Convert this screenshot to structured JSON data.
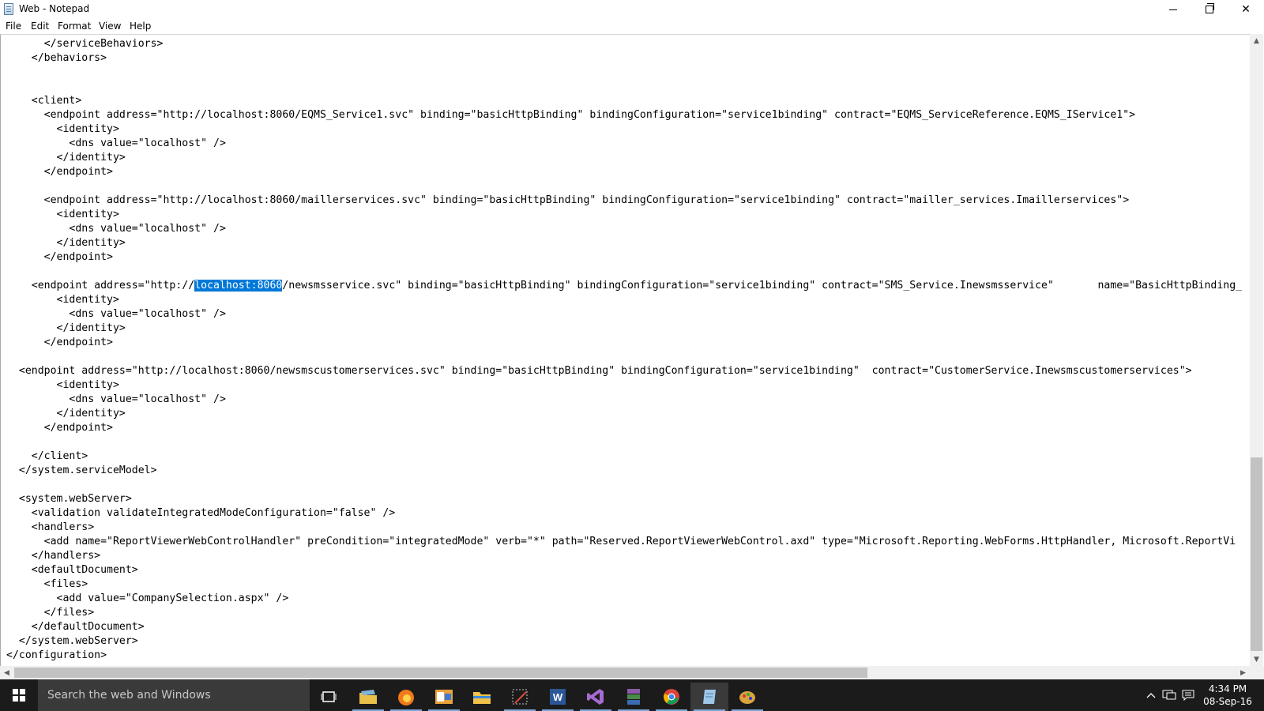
{
  "window": {
    "title": "Web - Notepad",
    "controls": {
      "minimize": "minimize",
      "maximize": "restore",
      "close": "✕"
    }
  },
  "menu": [
    "File",
    "Edit",
    "Format",
    "View",
    "Help"
  ],
  "editor": {
    "before_selection": "      </serviceBehaviors>\n    </behaviors>\n\n\n    <client>\n      <endpoint address=\"http://localhost:8060/EQMS_Service1.svc\" binding=\"basicHttpBinding\" bindingConfiguration=\"service1binding\" contract=\"EQMS_ServiceReference.EQMS_IService1\">\n        <identity>\n          <dns value=\"localhost\" />\n        </identity>\n      </endpoint>\n\n      <endpoint address=\"http://localhost:8060/maillerservices.svc\" binding=\"basicHttpBinding\" bindingConfiguration=\"service1binding\" contract=\"mailler_services.Imaillerservices\">\n        <identity>\n          <dns value=\"localhost\" />\n        </identity>\n      </endpoint>\n\n    <endpoint address=\"http://",
    "selected": "localhost:8060",
    "after_selection": "/newsmsservice.svc\" binding=\"basicHttpBinding\" bindingConfiguration=\"service1binding\" contract=\"SMS_Service.Inewsmsservice\"       name=\"BasicHttpBinding_\n        <identity>\n          <dns value=\"localhost\" />\n        </identity>\n      </endpoint>\n\n  <endpoint address=\"http://localhost:8060/newsmscustomerservices.svc\" binding=\"basicHttpBinding\" bindingConfiguration=\"service1binding\"  contract=\"CustomerService.Inewsmscustomerservices\">\n        <identity>\n          <dns value=\"localhost\" />\n        </identity>\n      </endpoint>\n\n    </client>\n  </system.serviceModel>\n\n  <system.webServer>\n    <validation validateIntegratedModeConfiguration=\"false\" />\n    <handlers>\n      <add name=\"ReportViewerWebControlHandler\" preCondition=\"integratedMode\" verb=\"*\" path=\"Reserved.ReportViewerWebControl.axd\" type=\"Microsoft.Reporting.WebForms.HttpHandler, Microsoft.ReportVi\n    </handlers>\n    <defaultDocument>\n      <files>\n        <add value=\"CompanySelection.aspx\" />\n      </files>\n    </defaultDocument>\n  </system.webServer>\n</configuration>"
  },
  "taskbar": {
    "search_placeholder": "Search the web and Windows",
    "apps": [
      {
        "name": "task-view-icon",
        "color": "#ffffff"
      },
      {
        "name": "files-icon",
        "color": "#e8c04a"
      },
      {
        "name": "firefox-icon",
        "color": "#f07a1a"
      },
      {
        "name": "outlook-icon",
        "color": "#e9a23b"
      },
      {
        "name": "file-explorer-icon",
        "color": "#f0c24a"
      },
      {
        "name": "snipping-tool-icon",
        "color": "#c9c9c9"
      },
      {
        "name": "word-icon",
        "color": "#2b5797"
      },
      {
        "name": "visual-studio-icon",
        "color": "#68217a"
      },
      {
        "name": "winrar-icon",
        "color": "#8b5aa8"
      },
      {
        "name": "chrome-icon",
        "color": "#db4437"
      },
      {
        "name": "notepad-icon",
        "color": "#9fc7e8"
      },
      {
        "name": "paint-icon",
        "color": "#d9a43c"
      }
    ],
    "clock": {
      "time": "4:34 PM",
      "date": "08-Sep-16"
    }
  }
}
